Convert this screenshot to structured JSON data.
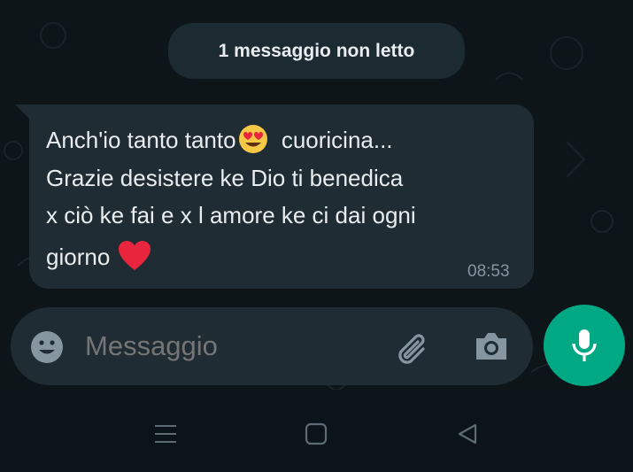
{
  "chat": {
    "unread_label": "1 messaggio non letto",
    "message": {
      "lines": [
        "Anch'io tanto tanto",
        "cuoricina...",
        "Grazie desistere ke Dio ti benedica",
        "x ciò ke fai e x l amore ke ci dai ogni",
        "giorno"
      ],
      "time": "08:53",
      "emojis": [
        "heart-eyes-emoji",
        "red-heart-emoji"
      ]
    }
  },
  "composer": {
    "placeholder": "Messaggio",
    "icons": [
      "emoji-icon",
      "attach-icon",
      "camera-icon",
      "mic-icon"
    ]
  },
  "navigation": {
    "icons": [
      "recent-apps-icon",
      "home-icon",
      "back-icon"
    ]
  },
  "colors": {
    "background": "#0b141a",
    "bubble": "#1f2c34",
    "accent": "#00a884",
    "text": "#e9edef",
    "muted": "#8696a0"
  }
}
